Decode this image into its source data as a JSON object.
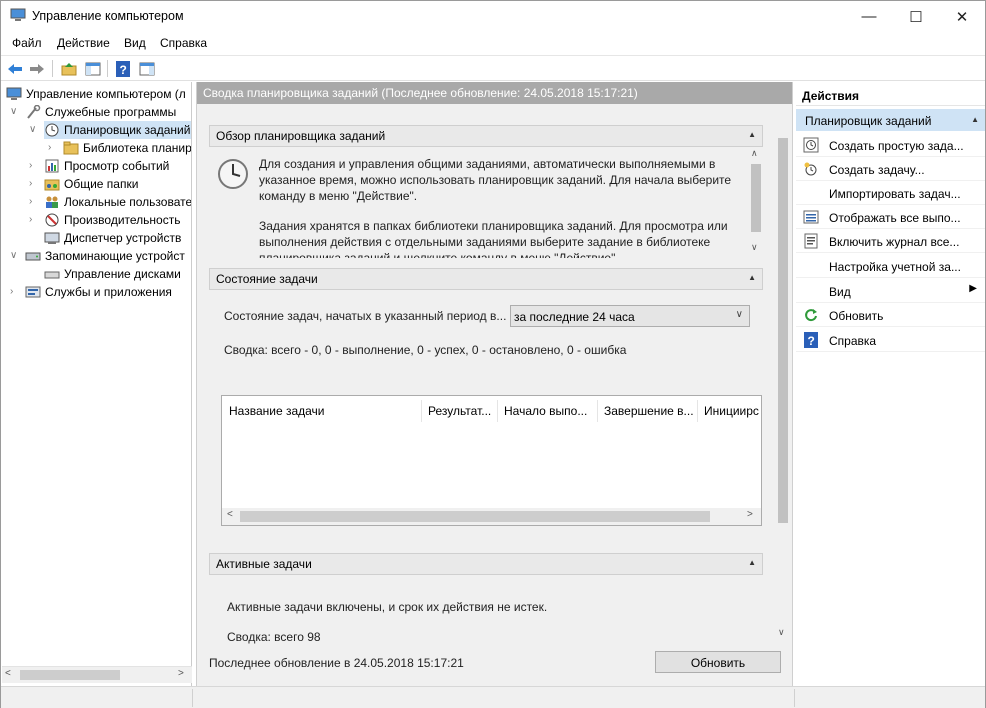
{
  "window": {
    "title": "Управление компьютером",
    "min": "—",
    "max": "☐",
    "close": "✕"
  },
  "menu": [
    "Файл",
    "Действие",
    "Вид",
    "Справка"
  ],
  "toolbar": {
    "icons": [
      "back-arrow-icon",
      "forward-arrow-icon",
      "up-folder-icon",
      "console-tree-icon",
      "help-icon",
      "action-pane-icon"
    ]
  },
  "tree": {
    "root": "Управление компьютером (л",
    "system_tools": "Служебные программы",
    "task_scheduler": "Планировщик заданий",
    "task_library": "Библиотека планир",
    "event_viewer": "Просмотр событий",
    "shared_folders": "Общие папки",
    "local_users": "Локальные пользовате",
    "performance": "Производительность",
    "device_manager": "Диспетчер устройств",
    "storage": "Запоминающие устройст",
    "disk_management": "Управление дисками",
    "services_apps": "Службы и приложения"
  },
  "center": {
    "header": "Сводка планировщика заданий (Последнее обновление: 24.05.2018 15:17:21)",
    "overview": {
      "title": "Обзор планировщика заданий",
      "p1": "Для создания и управления общими заданиями, автоматически выполняемыми в указанное время, можно использовать планировщик заданий. Для начала выберите команду в меню \"Действие\".",
      "p2": "Задания хранятся в папках библиотеки планировщика заданий. Для просмотра или выполнения действия с отдельными заданиями выберите задание в библиотеке планировщика заданий и щелкните команду в меню \"Действие\"."
    },
    "status": {
      "title": "Состояние задачи",
      "period_label": "Состояние задач, начатых в указанный период в...",
      "period_value": "за последние 24 часа",
      "summary": "Сводка: всего - 0, 0 - выполнение, 0 - успех, 0 - остановлено, 0 - ошибка",
      "columns": [
        "Название задачи",
        "Результат...",
        "Начало выпо...",
        "Завершение в...",
        "Инициирс"
      ]
    },
    "active": {
      "title": "Активные задачи",
      "line1": "Активные задачи включены, и срок их действия не истек.",
      "line2": "Сводка: всего 98"
    },
    "footer": {
      "last_update": "Последнее обновление в 24.05.2018 15:17:21",
      "refresh": "Обновить"
    }
  },
  "actions": {
    "title": "Действия",
    "group": "Планировщик заданий",
    "items": [
      {
        "label": "Создать простую зада...",
        "icon": "clock-wizard-icon"
      },
      {
        "label": "Создать задачу...",
        "icon": "clock-new-icon"
      },
      {
        "label": "Импортировать задач...",
        "icon": ""
      },
      {
        "label": "Отображать все выпо...",
        "icon": "list-icon"
      },
      {
        "label": "Включить журнал все...",
        "icon": "log-icon"
      },
      {
        "label": "Настройка учетной за...",
        "icon": ""
      },
      {
        "label": "Вид",
        "icon": ""
      },
      {
        "label": "Обновить",
        "icon": "refresh-icon"
      },
      {
        "label": "Справка",
        "icon": "help-icon"
      }
    ]
  },
  "colors": {
    "accent": "#cfe3f5",
    "header_bg": "#a9a9a9",
    "pane_bg": "#f0f0f0"
  }
}
